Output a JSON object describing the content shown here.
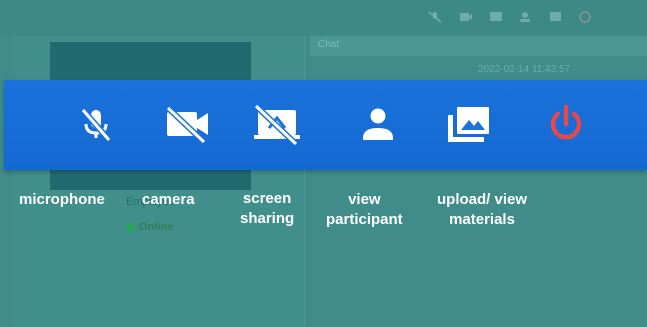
{
  "background": {
    "employee_label": "Employee",
    "status": "Online",
    "chat_title": "Chat",
    "chat_timestamp": "2022-02-14 11:43:57"
  },
  "toolbar": {
    "items": [
      {
        "icon": "microphone-off-icon",
        "label": "microphone"
      },
      {
        "icon": "camera-off-icon",
        "label": "camera"
      },
      {
        "icon": "screen-share-off-icon",
        "label": "screen sharing"
      },
      {
        "icon": "person-icon",
        "label": "view participant"
      },
      {
        "icon": "image-library-icon",
        "label": "upload/ view materials"
      },
      {
        "icon": "power-icon",
        "label": ""
      }
    ]
  },
  "captions": {
    "microphone": "microphone",
    "camera": "camera",
    "screen_line1": "screen",
    "screen_line2": "sharing",
    "view_line1": "view",
    "view_line2": "participant",
    "upload_line1": "upload/ view",
    "upload_line2": "materials"
  },
  "colors": {
    "toolbar_blue": "#1a72da",
    "icon_white": "#ffffff",
    "power_red": "#e5484d",
    "backdrop_teal": "#3a8a86"
  }
}
